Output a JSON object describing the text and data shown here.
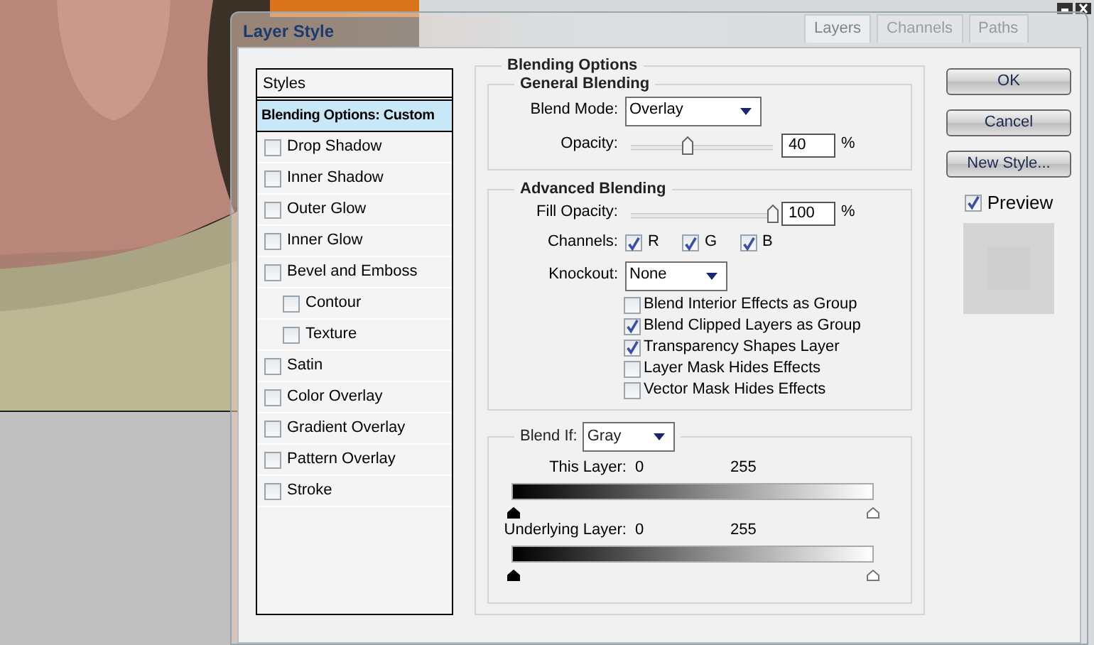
{
  "desktop": {
    "panel_tabs": [
      {
        "label": "Layers",
        "selected": true
      },
      {
        "label": "Channels",
        "selected": false
      },
      {
        "label": "Paths",
        "selected": false
      }
    ]
  },
  "dialog": {
    "title": "Layer Style"
  },
  "styles_list": {
    "header": "Styles",
    "items": [
      {
        "label": "Blending Options: Custom",
        "kind": "heading",
        "selected": true
      },
      {
        "label": "Drop Shadow",
        "kind": "checkbox",
        "checked": false,
        "selected": false
      },
      {
        "label": "Inner Shadow",
        "kind": "checkbox",
        "checked": false,
        "selected": false
      },
      {
        "label": "Outer Glow",
        "kind": "checkbox",
        "checked": false,
        "selected": false
      },
      {
        "label": "Inner Glow",
        "kind": "checkbox",
        "checked": false,
        "selected": false
      },
      {
        "label": "Bevel and Emboss",
        "kind": "checkbox",
        "checked": false,
        "selected": false,
        "children": [
          {
            "label": "Contour",
            "kind": "checkbox",
            "checked": false,
            "selected": false
          },
          {
            "label": "Texture",
            "kind": "checkbox",
            "checked": false,
            "selected": false
          }
        ]
      },
      {
        "label": "Satin",
        "kind": "checkbox",
        "checked": false,
        "selected": false
      },
      {
        "label": "Color Overlay",
        "kind": "checkbox",
        "checked": false,
        "selected": false
      },
      {
        "label": "Gradient Overlay",
        "kind": "checkbox",
        "checked": false,
        "selected": false
      },
      {
        "label": "Pattern Overlay",
        "kind": "checkbox",
        "checked": false,
        "selected": false
      },
      {
        "label": "Stroke",
        "kind": "checkbox",
        "checked": false,
        "selected": false
      }
    ]
  },
  "blending": {
    "title": "Blending Options",
    "general": {
      "title": "General Blending",
      "blend_mode": {
        "label": "Blend Mode:",
        "value": "Overlay"
      },
      "opacity": {
        "label": "Opacity:",
        "level": 0.4,
        "value": "40",
        "unit": "%"
      }
    },
    "advanced": {
      "title": "Advanced Blending",
      "fill_opacity": {
        "label": "Fill Opacity:",
        "level": 1,
        "value": "100",
        "unit": "%"
      },
      "channels": {
        "label": "Channels:",
        "items": [
          {
            "label": "R",
            "checked": true
          },
          {
            "label": "G",
            "checked": true
          },
          {
            "label": "B",
            "checked": true
          }
        ]
      },
      "knockout": {
        "label": "Knockout:",
        "value": "None"
      },
      "options": [
        {
          "label": "Blend Interior Effects as Group",
          "checked": false
        },
        {
          "label": "Blend Clipped Layers as Group",
          "checked": true
        },
        {
          "label": "Transparency Shapes Layer",
          "checked": true
        },
        {
          "label": "Layer Mask Hides Effects",
          "checked": false
        },
        {
          "label": "Vector Mask Hides Effects",
          "checked": false
        }
      ]
    },
    "blend_if": {
      "label": "Blend If:",
      "value": "Gray",
      "ranges": [
        {
          "label": "This Layer:",
          "low": "0",
          "high": "255"
        },
        {
          "label": "Underlying Layer:",
          "low": "0",
          "high": "255"
        }
      ]
    }
  },
  "buttons": [
    "OK",
    "Cancel",
    "New Style..."
  ],
  "preview": {
    "label": "Preview",
    "checked": true
  }
}
